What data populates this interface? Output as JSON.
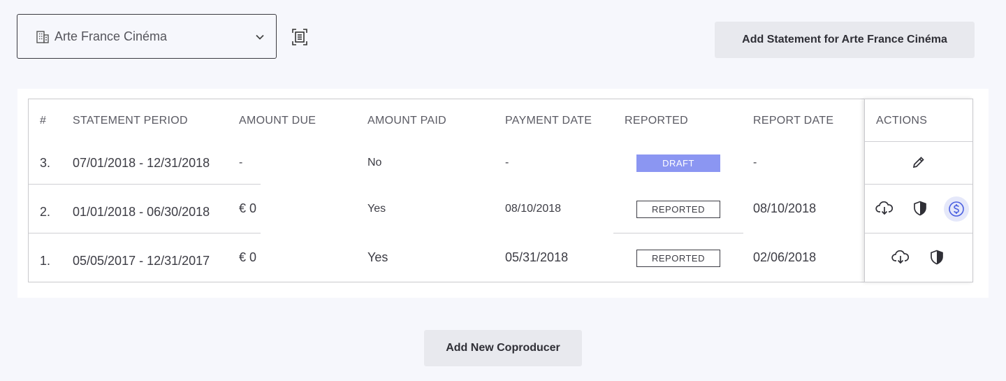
{
  "selector": {
    "value": "Arte France Cinéma"
  },
  "add_statement_label": "Add Statement for Arte France Cinéma",
  "add_coproducer_label": "Add New Coproducer",
  "table": {
    "headers": {
      "num": "#",
      "period": "STATEMENT PERIOD",
      "amount_due": "AMOUNT DUE",
      "amount_paid": "AMOUNT PAID",
      "payment_date": "PAYMENT DATE",
      "reported": "REPORTED",
      "report_date": "REPORT DATE",
      "actions": "ACTIONS"
    },
    "rows": [
      {
        "num": "3.",
        "period": "07/01/2018 - 12/31/2018",
        "amount_due": "-",
        "amount_paid": "No",
        "payment_date": "-",
        "status": "DRAFT",
        "report_date": "-"
      },
      {
        "num": "2.",
        "period": "01/01/2018 - 06/30/2018",
        "amount_due": "€ 0",
        "amount_paid": "Yes",
        "payment_date": "08/10/2018",
        "status": "REPORTED",
        "report_date": "08/10/2018"
      },
      {
        "num": "1.",
        "period": "05/05/2017 - 12/31/2017",
        "amount_due": "€ 0",
        "amount_paid": "Yes",
        "payment_date": "05/31/2018",
        "status": "REPORTED",
        "report_date": "02/06/2018"
      }
    ]
  },
  "colors": {
    "draft_badge": "#8b96f2",
    "accent": "#4a5fe0",
    "page_bg": "#f6f7fc"
  }
}
